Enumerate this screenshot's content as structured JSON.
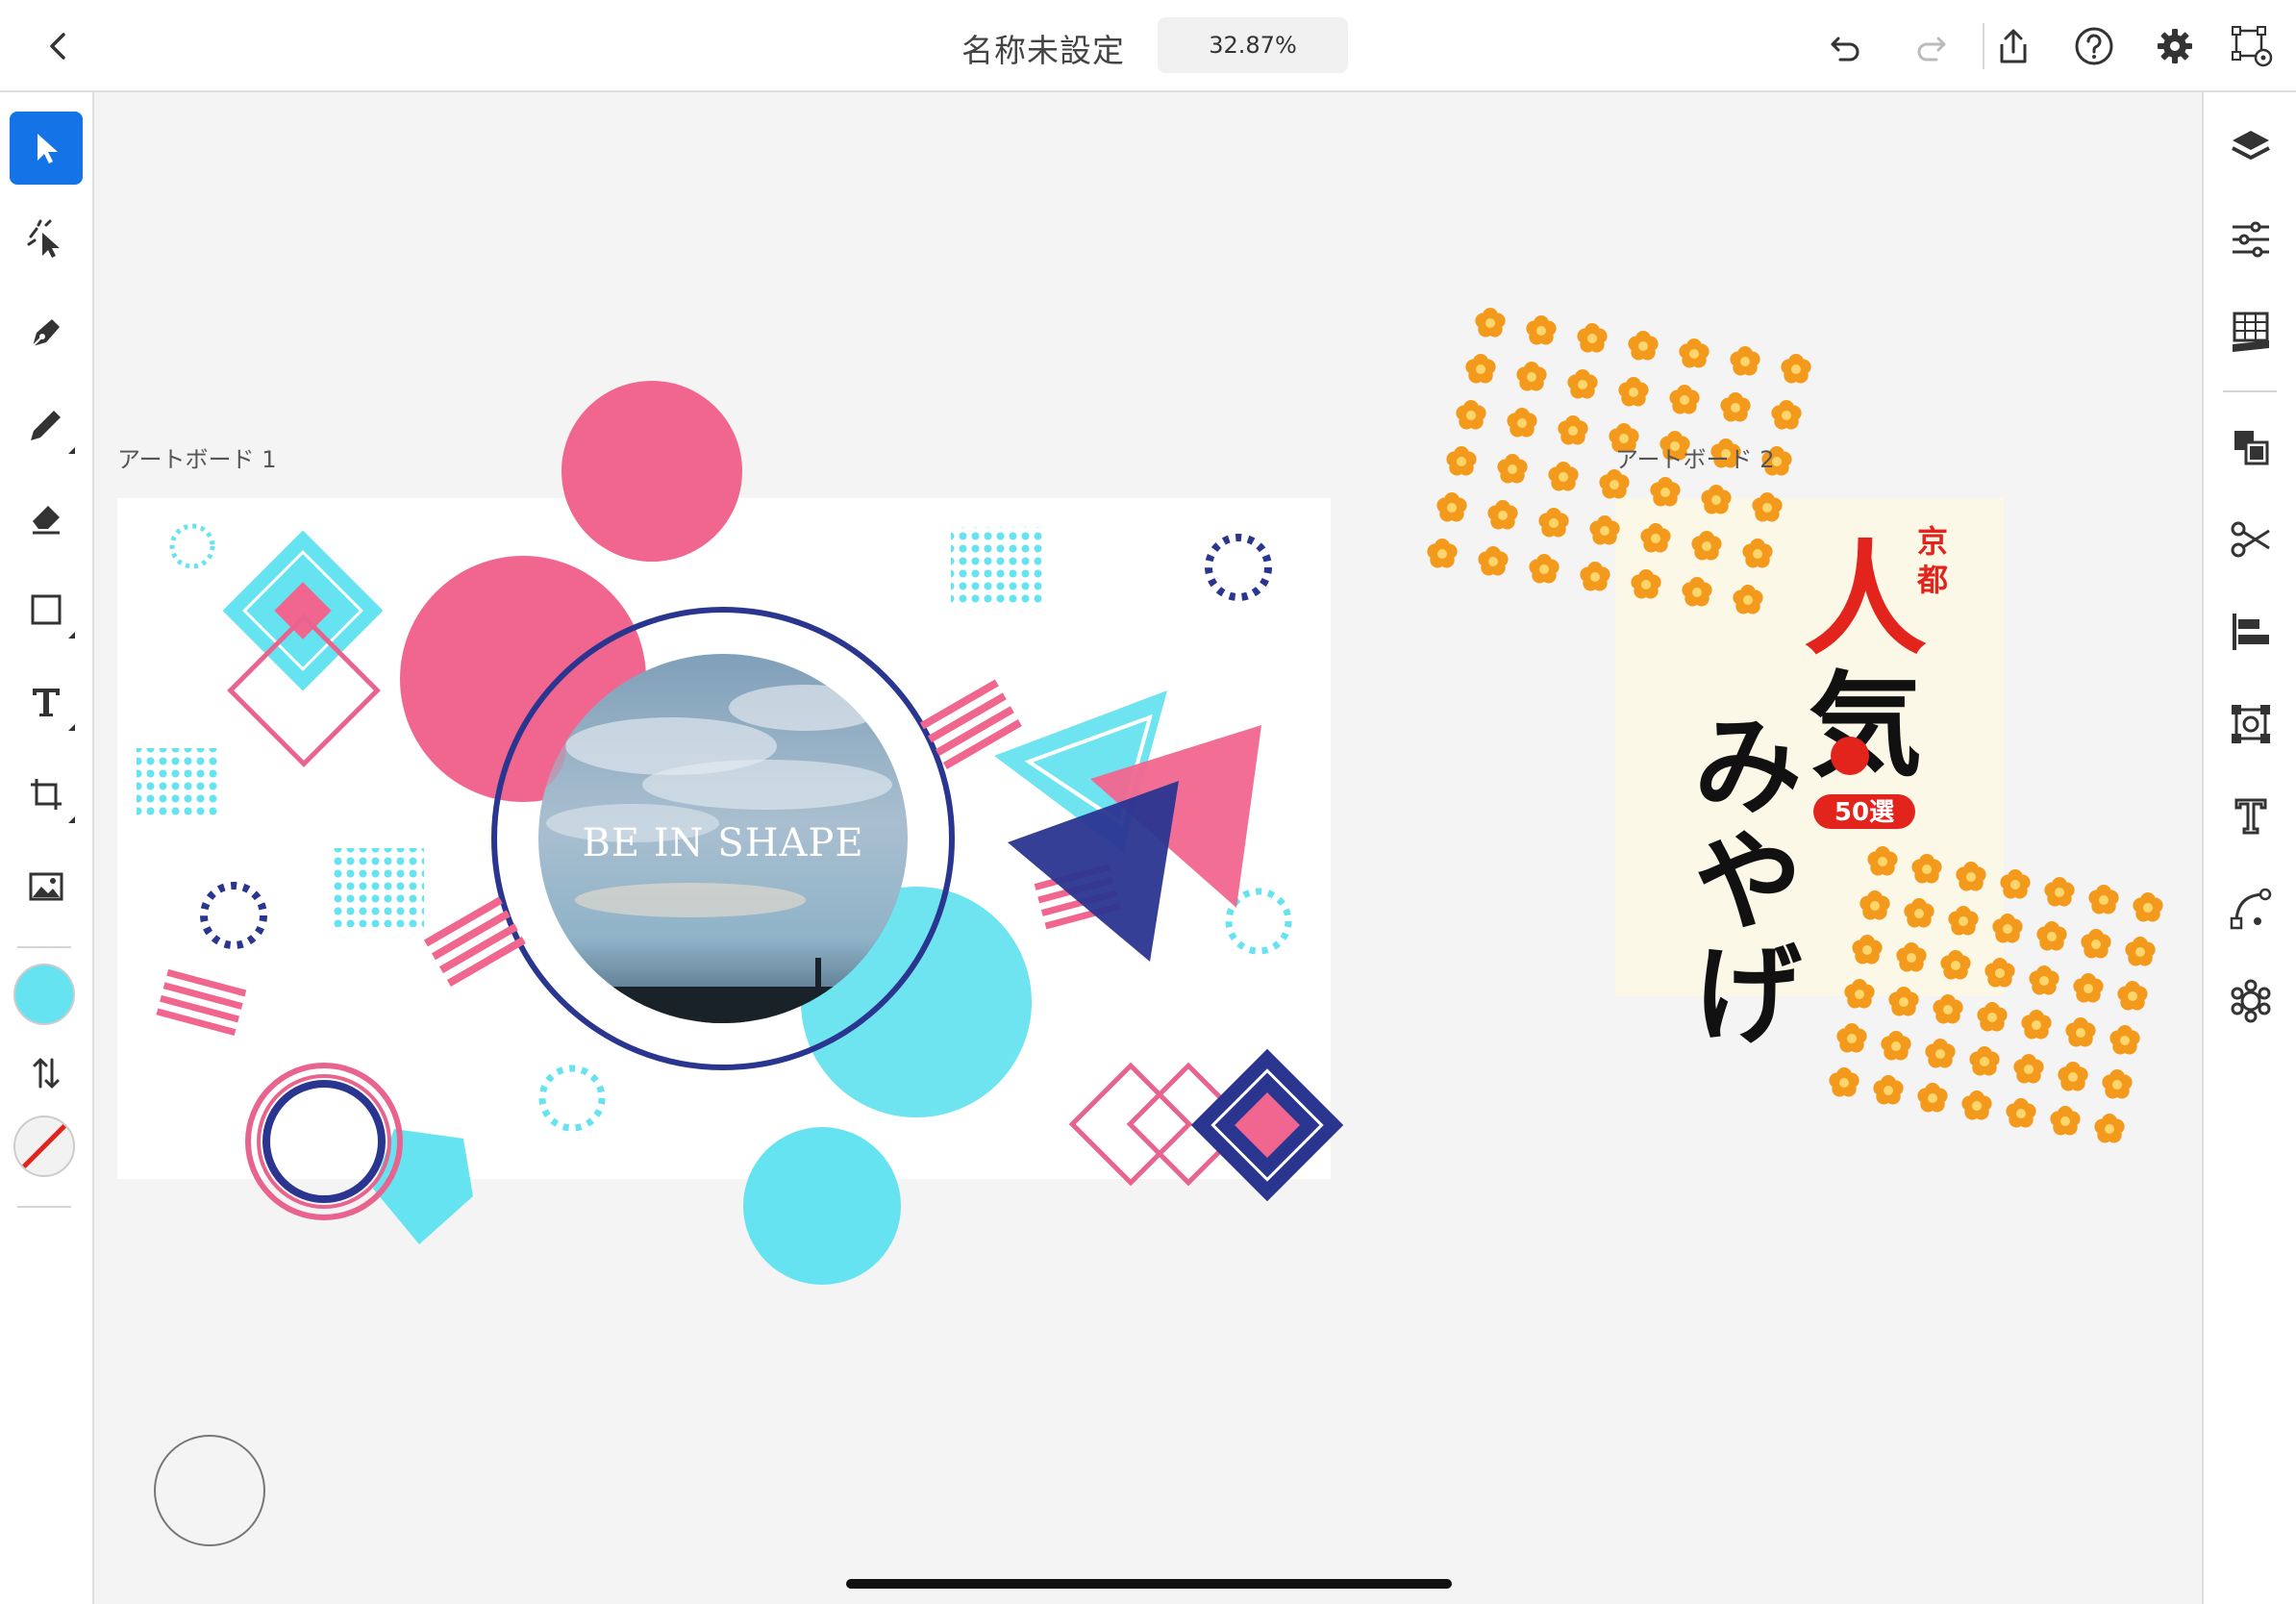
{
  "header": {
    "title": "名称未設定",
    "zoom": "32.87%"
  },
  "icons": {
    "back": "chevron-left-icon",
    "undo": "undo-icon",
    "redo": "redo-icon",
    "share": "share-icon",
    "help": "help-icon",
    "settings": "gear-icon",
    "artboard_settings": "artboard-icon"
  },
  "toolbar": {
    "tools": [
      "selection",
      "direct-selection",
      "pen",
      "pencil",
      "eraser",
      "shape",
      "type",
      "artboard",
      "image"
    ],
    "fill_color": "#66e3f0",
    "stroke": "none"
  },
  "right_panel": {
    "icons": [
      "layers",
      "properties",
      "libraries",
      "arrange",
      "cut",
      "align",
      "transform",
      "text",
      "path",
      "effects"
    ]
  },
  "canvas": {
    "artboards": [
      {
        "label": "アートボード 1",
        "text": "BE IN SHAPE"
      },
      {
        "label": "アートボード 2",
        "text_small": "京都",
        "text_big_1": "人",
        "text_big_2": "気",
        "text_vertical": "みやげ",
        "badge": "50選"
      }
    ]
  },
  "colors": {
    "accent": "#1473e6",
    "pink": "#f1668f",
    "cyan": "#66e3f0",
    "navy": "#2a3590",
    "orange": "#f39a1c",
    "red": "#e2241d"
  }
}
